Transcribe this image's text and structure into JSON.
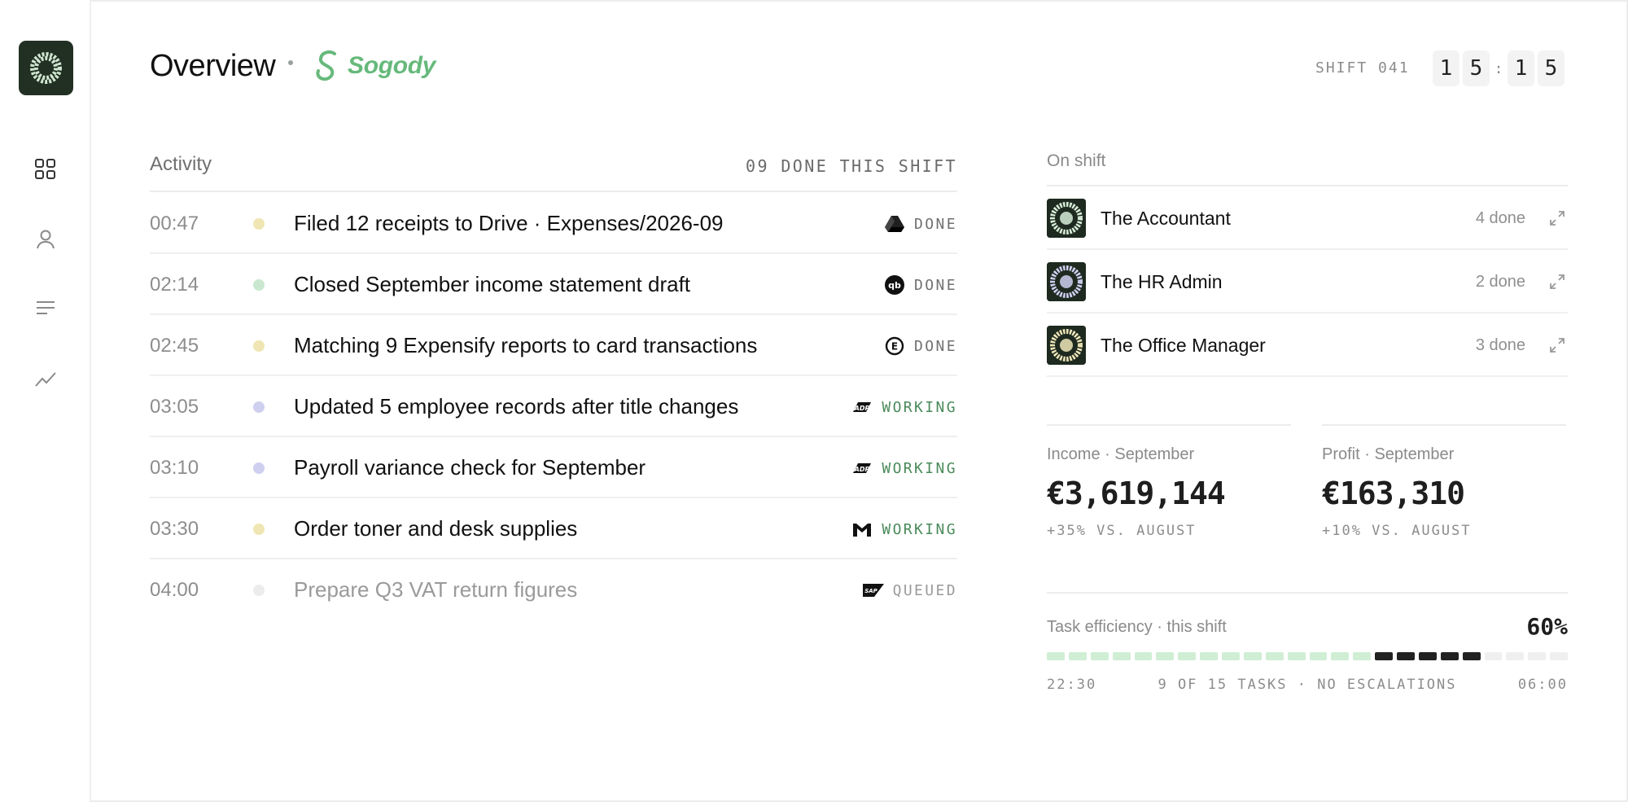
{
  "header": {
    "title": "Overview",
    "brand": "Sogody",
    "shift_label": "SHIFT 041",
    "clock": {
      "d1": "1",
      "d2": "5",
      "sep": ":",
      "d3": "1",
      "d4": "5"
    }
  },
  "sidebar": {
    "items": [
      {
        "icon": "dashboard-icon"
      },
      {
        "icon": "user-icon"
      },
      {
        "icon": "list-icon"
      },
      {
        "icon": "chart-icon"
      }
    ]
  },
  "activity": {
    "title": "Activity",
    "count": "09 DONE THIS SHIFT",
    "rows": [
      {
        "time": "00:47",
        "text": "Filed 12 receipts to Drive · Expenses/2026-09",
        "status": "DONE",
        "app_icon": "google-drive-icon",
        "dot_color": "#efe6b4"
      },
      {
        "time": "02:14",
        "text": "Closed September income statement draft",
        "status": "DONE",
        "app_icon": "quickbooks-icon",
        "dot_color": "#c9e8cf"
      },
      {
        "time": "02:45",
        "text": "Matching 9 Expensify reports to card transactions",
        "status": "DONE",
        "app_icon": "expensify-icon",
        "dot_color": "#efe6b4"
      },
      {
        "time": "03:05",
        "text": "Updated 5 employee records after title changes",
        "status": "WORKING",
        "app_icon": "adp-icon",
        "dot_color": "#cfd0ef"
      },
      {
        "time": "03:10",
        "text": "Payroll variance check for September",
        "status": "WORKING",
        "app_icon": "adp-icon",
        "dot_color": "#cfd0ef"
      },
      {
        "time": "03:30",
        "text": "Order toner and desk supplies",
        "status": "WORKING",
        "app_icon": "gmail-icon",
        "dot_color": "#efe6b4"
      },
      {
        "time": "04:00",
        "text": "Prepare Q3 VAT return figures",
        "status": "QUEUED",
        "app_icon": "sap-icon",
        "dot_color": "#ececec"
      }
    ]
  },
  "on_shift": {
    "title": "On shift",
    "agents": [
      {
        "name": "The Accountant",
        "done": "4 done",
        "avatar_color": "#d7ecd9"
      },
      {
        "name": "The HR Admin",
        "done": "2 done",
        "avatar_color": "#cfd0f0"
      },
      {
        "name": "The Office Manager",
        "done": "3 done",
        "avatar_color": "#eee6b8"
      }
    ]
  },
  "metrics": {
    "income": {
      "label": "Income · September",
      "value": "€3,619,144",
      "delta": "+35% VS. AUGUST"
    },
    "profit": {
      "label": "Profit · September",
      "value": "€163,310",
      "delta": "+10% VS. AUGUST"
    }
  },
  "efficiency": {
    "label": "Task efficiency · this shift",
    "percent": "60%",
    "start": "22:30",
    "summary": "9 OF 15 TASKS · NO ESCALATIONS",
    "end": "06:00",
    "segments_done": 15,
    "segments_active": 5,
    "segments_total": 24
  },
  "colors": {
    "brand_green": "#66b97b",
    "status_done": "#707070",
    "status_working": "#4a8a5a",
    "status_queued": "#9a9a9a",
    "seg_done": "#cfeed4",
    "seg_active": "#222222",
    "seg_empty": "#efefef"
  }
}
